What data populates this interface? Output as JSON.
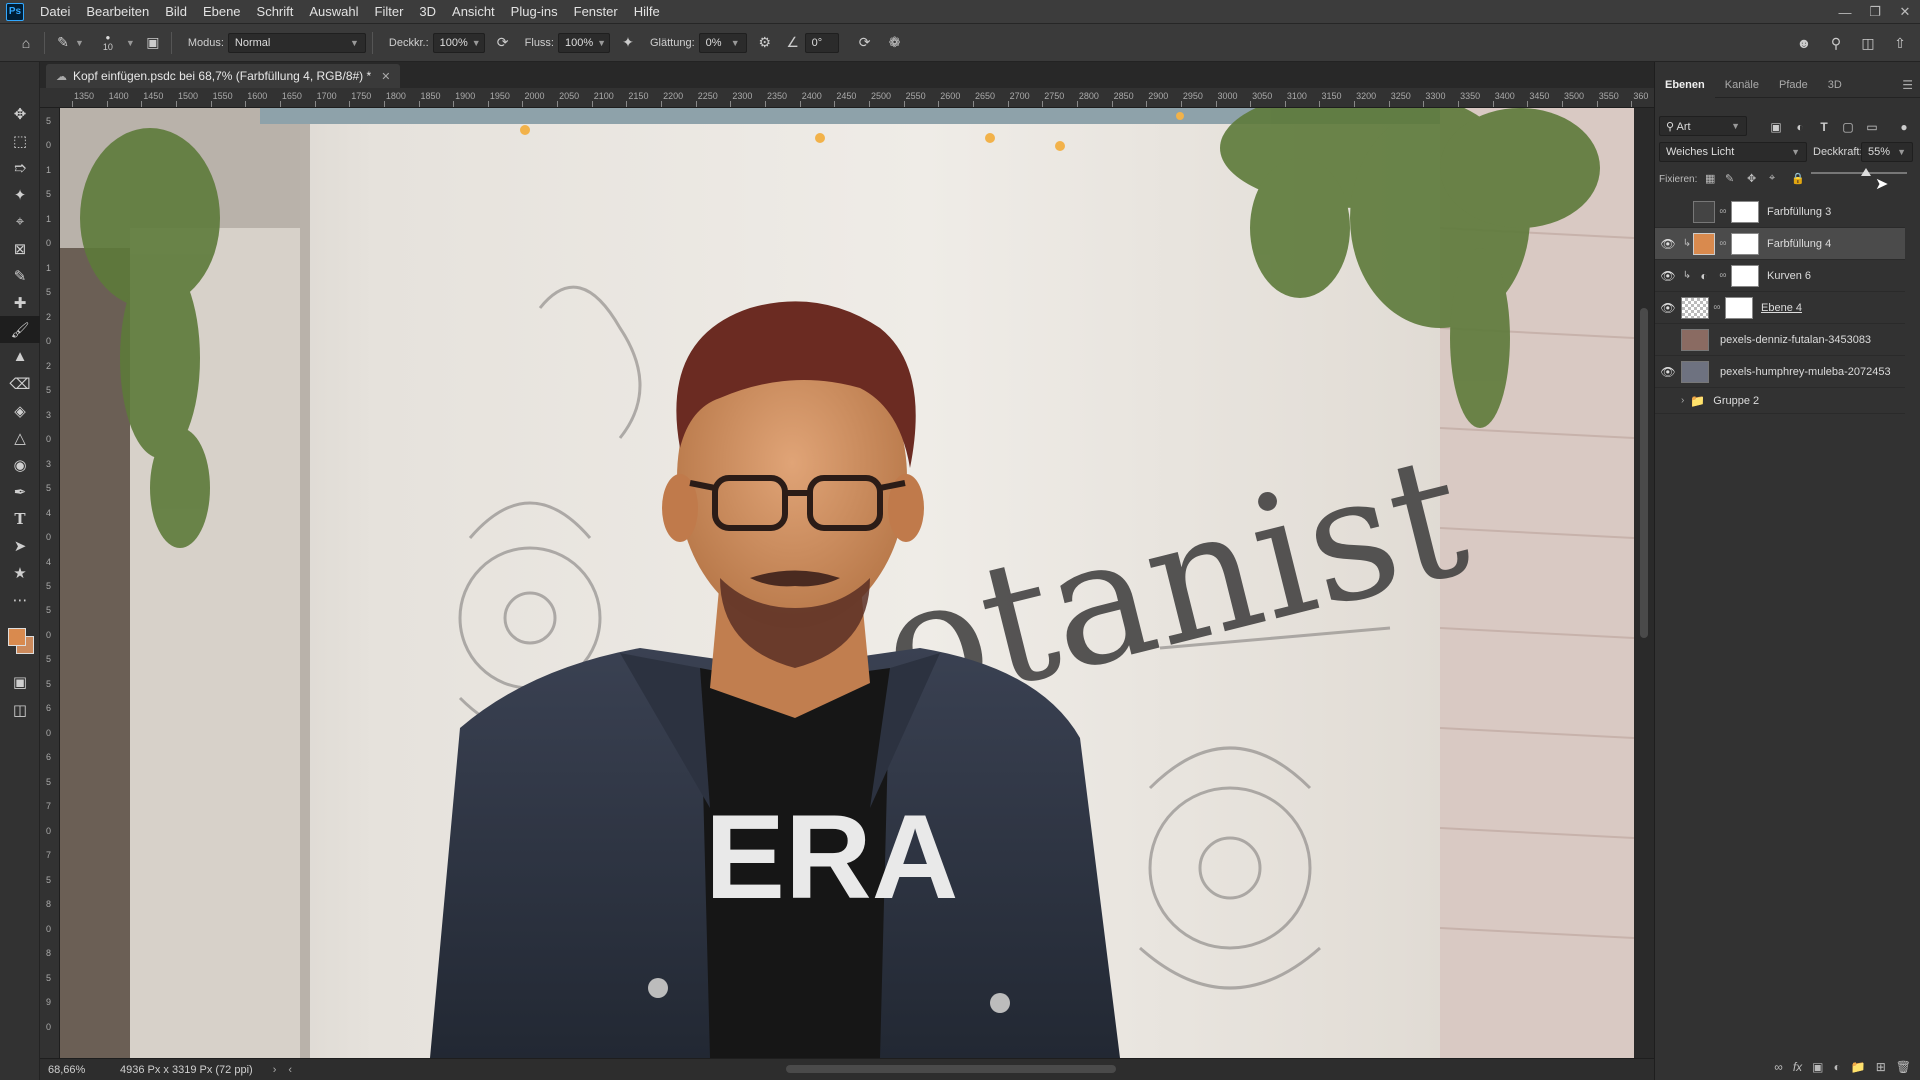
{
  "app": {
    "logo": "Ps"
  },
  "menu": [
    "Datei",
    "Bearbeiten",
    "Bild",
    "Ebene",
    "Schrift",
    "Auswahl",
    "Filter",
    "3D",
    "Ansicht",
    "Plug-ins",
    "Fenster",
    "Hilfe"
  ],
  "options": {
    "brush_size": "10",
    "modus_label": "Modus:",
    "modus_value": "Normal",
    "deckkraft_label": "Deckkr.:",
    "deckkraft_value": "100%",
    "fluss_label": "Fluss:",
    "fluss_value": "100%",
    "glaettung_label": "Glättung:",
    "glaettung_value": "0%",
    "winkel_value": "0°"
  },
  "document": {
    "tab_title": "Kopf einfügen.psdc bei 68,7% (Farbfüllung 4, RGB/8#) *",
    "zoom": "68,66%",
    "dimensions": "4936 Px x 3319 Px (72 ppi)"
  },
  "ruler_h": [
    "1350",
    "1400",
    "1450",
    "1500",
    "1550",
    "1600",
    "1650",
    "1700",
    "1750",
    "1800",
    "1850",
    "1900",
    "1950",
    "2000",
    "2050",
    "2100",
    "2150",
    "2200",
    "2250",
    "2300",
    "2350",
    "2400",
    "2450",
    "2500",
    "2550",
    "2600",
    "2650",
    "2700",
    "2750",
    "2800",
    "2850",
    "2900",
    "2950",
    "3000",
    "3050",
    "3100",
    "3150",
    "3200",
    "3250",
    "3300",
    "3350",
    "3400",
    "3450",
    "3500",
    "3550",
    "360"
  ],
  "ruler_v": [
    "5",
    "0",
    "1",
    "5",
    "1",
    "0",
    "1",
    "5",
    "2",
    "0",
    "2",
    "5",
    "3",
    "0",
    "3",
    "5",
    "4",
    "0",
    "4",
    "5",
    "5",
    "0",
    "5",
    "5",
    "6",
    "0",
    "6",
    "5",
    "7",
    "0",
    "7",
    "5",
    "8",
    "0",
    "8",
    "5",
    "9",
    "0"
  ],
  "colors": {
    "foreground": "#d98a4e",
    "background": "#cc8a5c"
  },
  "canvas_text": {
    "sign": "otanist",
    "shirt": "ERA"
  },
  "panel": {
    "tabs": [
      "Ebenen",
      "Kanäle",
      "Pfade",
      "3D"
    ],
    "filter_value": "Art",
    "blend_mode": "Weiches Licht",
    "deckkraft_label": "Deckkraft:",
    "deckkraft_value": "55%",
    "fixieren_label": "Fixieren:",
    "layers": [
      {
        "name": "Farbfüllung 3",
        "visible": false,
        "selected": false
      },
      {
        "name": "Farbfüllung 4",
        "visible": true,
        "selected": true
      },
      {
        "name": "Kurven 6",
        "visible": true,
        "selected": false
      },
      {
        "name": "Ebene 4",
        "visible": true,
        "selected": false
      },
      {
        "name": "pexels-denniz-futalan-3453083",
        "visible": false,
        "selected": false
      },
      {
        "name": "pexels-humphrey-muleba-2072453",
        "visible": true,
        "selected": false
      },
      {
        "name": "Gruppe 2",
        "visible": false,
        "selected": false
      }
    ]
  }
}
